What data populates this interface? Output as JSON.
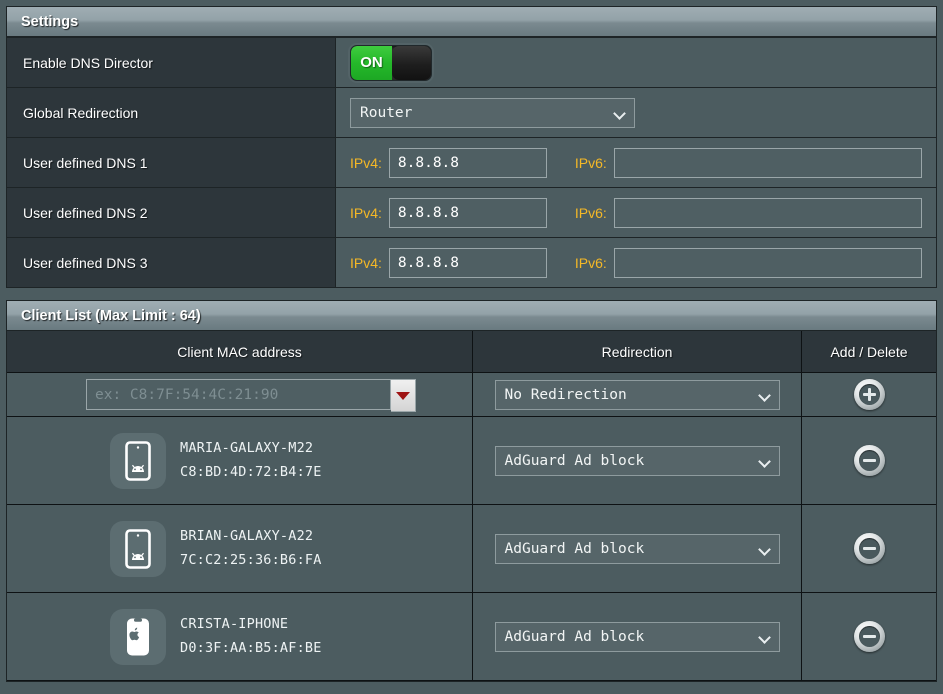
{
  "settings": {
    "title": "Settings",
    "rows": [
      {
        "label": "Enable DNS Director",
        "type": "toggle",
        "state": "ON"
      },
      {
        "label": "Global Redirection",
        "type": "select",
        "value": "Router"
      },
      {
        "label": "User defined DNS 1",
        "type": "dns",
        "ipv4_label": "IPv4:",
        "ipv4_value": "8.8.8.8",
        "ipv6_label": "IPv6:",
        "ipv6_value": ""
      },
      {
        "label": "User defined DNS 2",
        "type": "dns",
        "ipv4_label": "IPv4:",
        "ipv4_value": "8.8.8.8",
        "ipv6_label": "IPv6:",
        "ipv6_value": ""
      },
      {
        "label": "User defined DNS 3",
        "type": "dns",
        "ipv4_label": "IPv4:",
        "ipv4_value": "8.8.8.8",
        "ipv6_label": "IPv6:",
        "ipv6_value": ""
      }
    ]
  },
  "client_list": {
    "title": "Client List (Max Limit : 64)",
    "columns": {
      "mac": "Client MAC address",
      "redirection": "Redirection",
      "add_delete": "Add / Delete"
    },
    "new_entry": {
      "mac_placeholder": "ex: C8:7F:54:4C:21:90",
      "mac_value": "",
      "redirection": "No Redirection",
      "dropdown_icon": "triangle-down-icon",
      "action_icon": "plus-icon"
    },
    "clients": [
      {
        "name": "MARIA-GALAXY-M22",
        "mac": "C8:BD:4D:72:B4:7E",
        "device_icon": "android-phone-icon",
        "redirection": "AdGuard Ad block",
        "action_icon": "minus-icon"
      },
      {
        "name": "BRIAN-GALAXY-A22",
        "mac": "7C:C2:25:36:B6:FA",
        "device_icon": "android-phone-icon",
        "redirection": "AdGuard Ad block",
        "action_icon": "minus-icon"
      },
      {
        "name": "CRISTA-IPHONE",
        "mac": "D0:3F:AA:B5:AF:BE",
        "device_icon": "apple-iphone-icon",
        "redirection": "AdGuard Ad block",
        "action_icon": "minus-icon"
      }
    ]
  },
  "colors": {
    "accent_orange": "#f5b826",
    "toggle_on_green": "#25b82a",
    "panel_dark": "#2d363b",
    "panel_light": "#4c5c60",
    "dropdown_red": "#9e1414"
  }
}
